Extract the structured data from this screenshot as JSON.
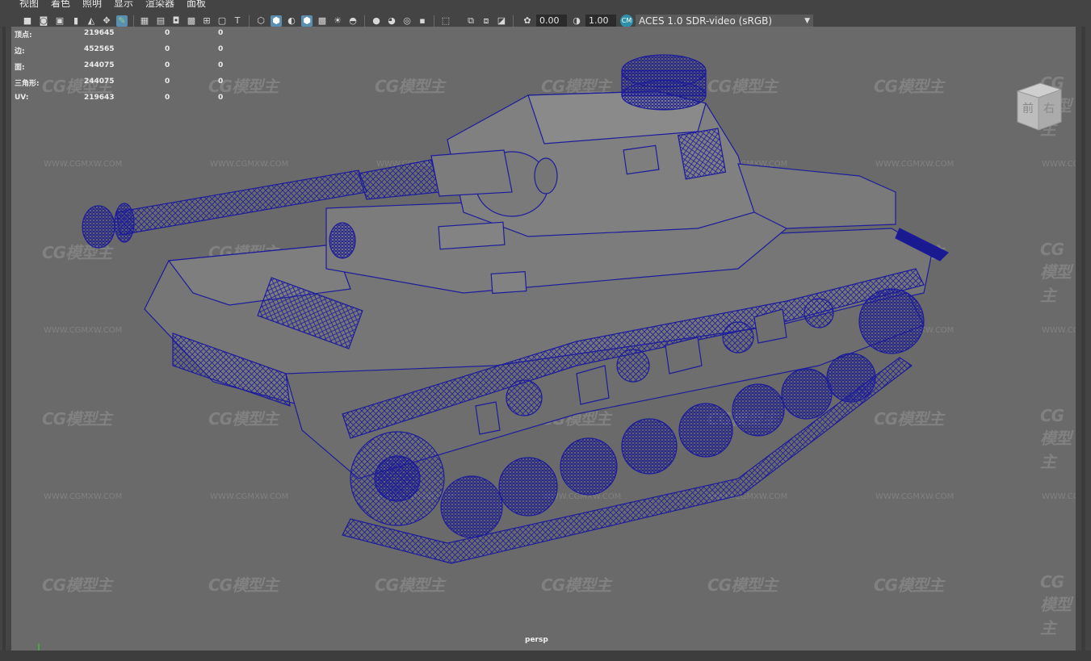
{
  "menu": {
    "items": [
      "视图",
      "着色",
      "照明",
      "显示",
      "渲染器",
      "面板"
    ]
  },
  "toolbar": {
    "icons": [
      "camera-select-icon",
      "camera-lock-icon",
      "camera-attr-icon",
      "bookmark-icon",
      "image-plane-icon",
      "2d-pan-icon",
      "grease-pencil-icon",
      "grid-icon",
      "film-gate-icon",
      "resolution-gate-icon",
      "gate-mask-icon",
      "field-chart-icon",
      "safe-action-icon",
      "safe-title-icon",
      "wireframe-icon",
      "smooth-shade-icon",
      "default-material-icon",
      "wireframe-on-shaded-icon",
      "textured-icon",
      "lights-icon",
      "shadows-icon",
      "screen-space-ao-icon",
      "motion-blur-icon",
      "anti-alias-icon",
      "depth-of-field-icon",
      "isolate-select-icon",
      "xray-icon",
      "xray-joints-icon",
      "xray-components-icon",
      "exposure-icon",
      "gamma-icon",
      "color-management-icon"
    ],
    "exposure_value": "0.00",
    "gamma_value": "1.00",
    "color_space": "ACES 1.0 SDR-video (sRGB)"
  },
  "hud": {
    "rows": [
      {
        "label": "顶点:",
        "v1": "219645",
        "v2": "0",
        "v3": "0"
      },
      {
        "label": "边:",
        "v1": "452565",
        "v2": "0",
        "v3": "0"
      },
      {
        "label": "面:",
        "v1": "244075",
        "v2": "0",
        "v3": "0"
      },
      {
        "label": "三角形:",
        "v1": "244075",
        "v2": "0",
        "v3": "0"
      },
      {
        "label": "UV:",
        "v1": "219643",
        "v2": "0",
        "v3": "0"
      }
    ]
  },
  "viewcube": {
    "front": "前",
    "right": "右"
  },
  "camera_label": "persp",
  "watermark": {
    "brand": "CG模型主",
    "url": "WWW.CGMXW.COM"
  },
  "colors": {
    "viewport_bg": "#6a6a6a",
    "wireframe": "#1a1a9a",
    "accent": "#5a8fb0"
  }
}
